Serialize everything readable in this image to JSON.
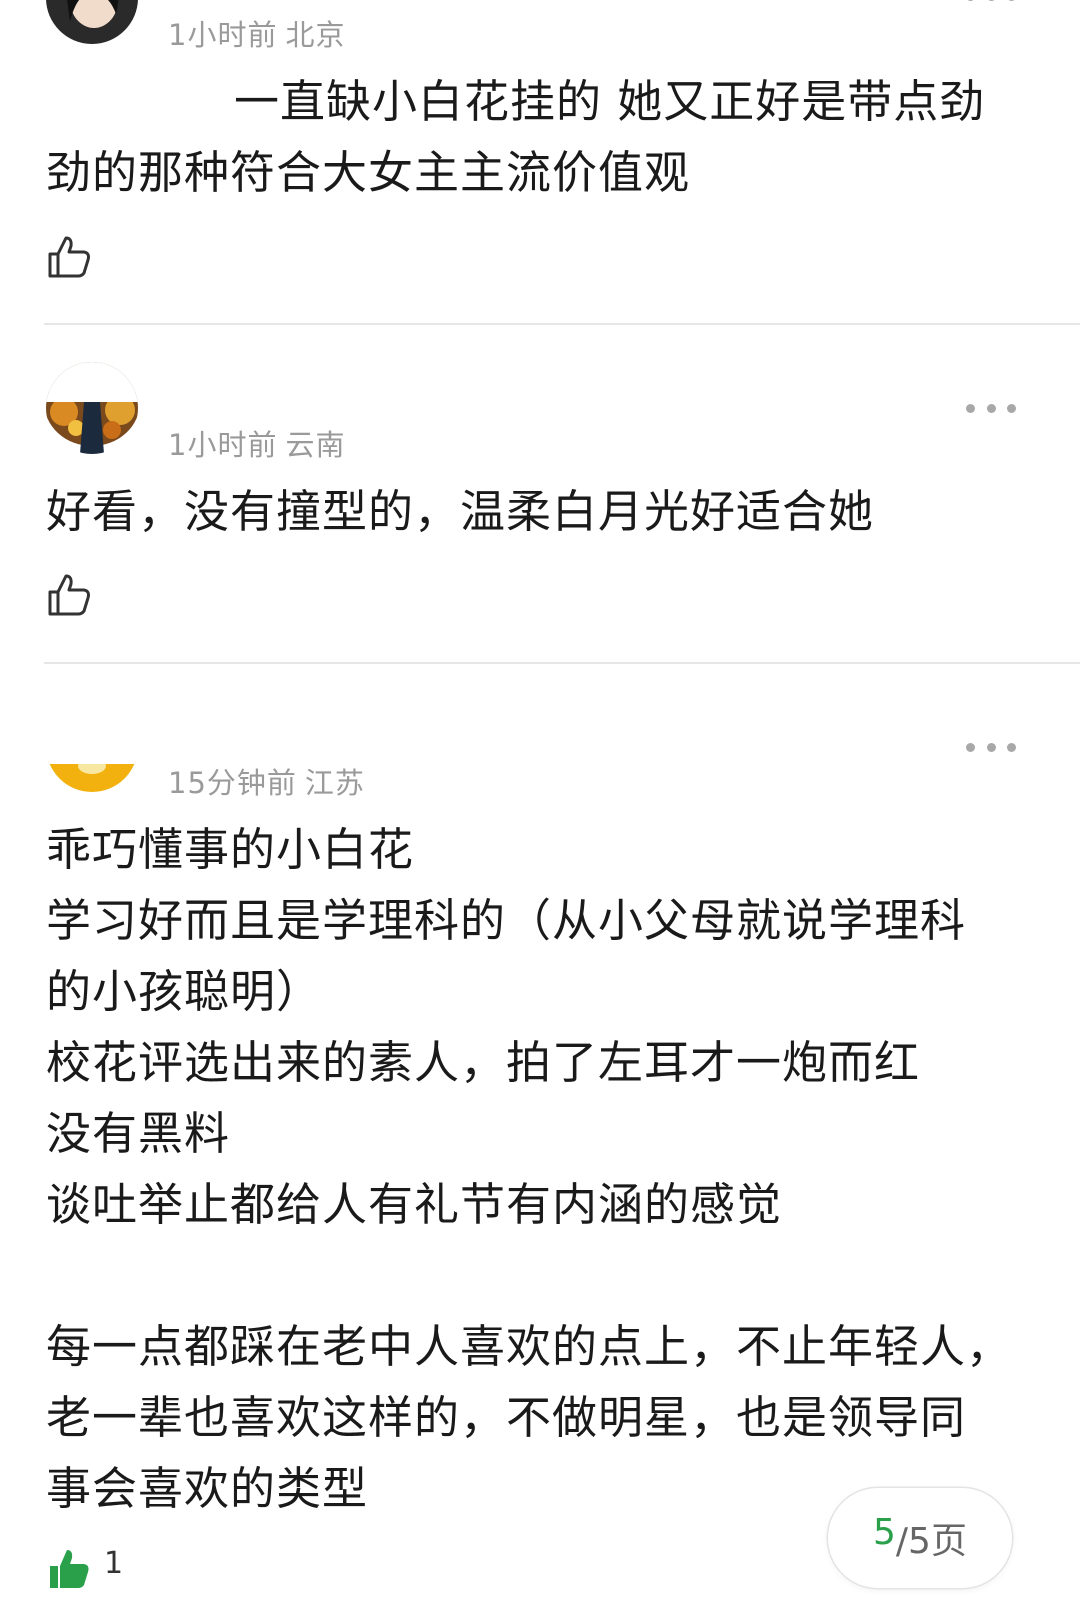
{
  "comments": [
    {
      "time": "1小时前",
      "location": "北京",
      "lines": [
        "一直缺小白花挂的 她又正好是带点劲",
        "劲的那种符合大女主主流价值观"
      ],
      "likes": ""
    },
    {
      "time": "1小时前",
      "location": "云南",
      "lines": [
        "好看，没有撞型的，温柔白月光好适合她"
      ],
      "likes": ""
    },
    {
      "time": "15分钟前",
      "location": "江苏",
      "lines": [
        "乖巧懂事的小白花",
        "学习好而且是学理科的（从小父母就说学理科",
        "的小孩聪明）",
        "校花评选出来的素人，拍了左耳才一炮而红",
        "没有黑料",
        "谈吐举止都给人有礼节有内涵的感觉",
        "",
        "每一点都踩在老中人喜欢的点上，不止年轻人，",
        "老一辈也喜欢这样的，不做明星，也是领导同",
        "事会喜欢的类型"
      ],
      "likes": "1"
    }
  ],
  "pager": {
    "current": "5",
    "rest": "/5页"
  },
  "colors": {
    "accent_green": "#2aa04a",
    "meta_gray": "#9a9a9a",
    "divider": "#e6e6e6"
  },
  "icons": {
    "like": "thumbs-up-icon",
    "like_active": "thumbs-up-filled-icon",
    "more": "more-dots-icon"
  }
}
